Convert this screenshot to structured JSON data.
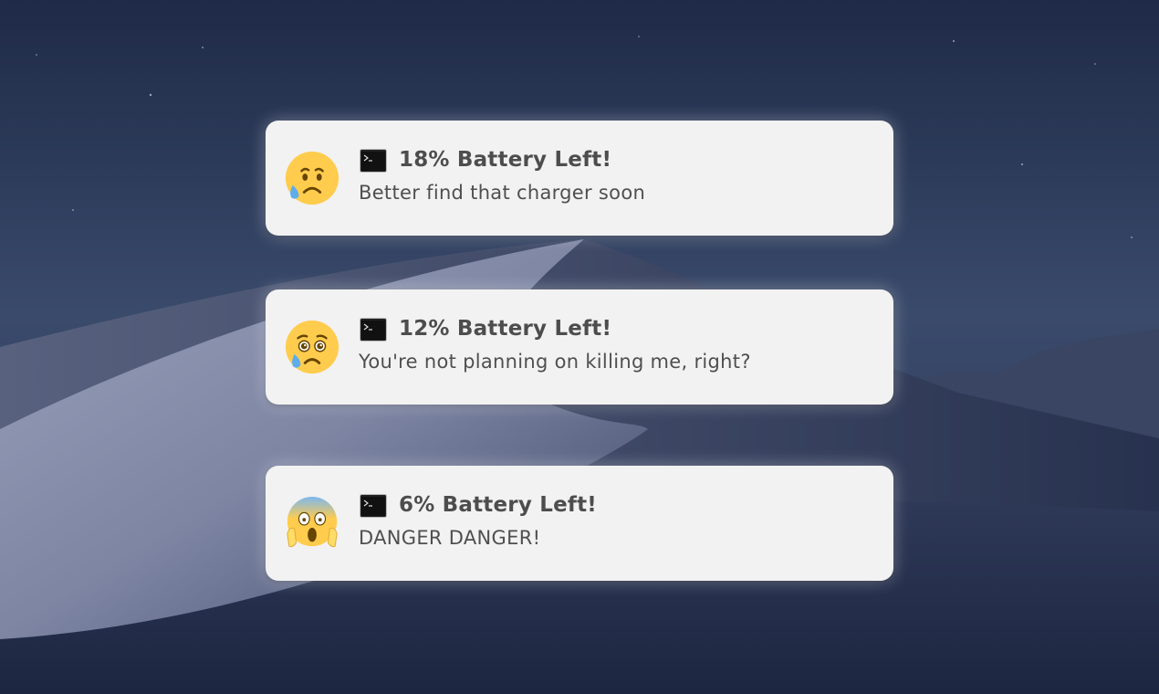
{
  "wallpaper": {
    "name": "desert-dune-night",
    "sky_color": "#2c3a5a",
    "dune_color": "#8c93ad"
  },
  "notifications": [
    {
      "app_icon": "terminal-icon",
      "emoji": "sad-but-relieved-face-icon",
      "title": "18% Battery Left!",
      "body": "Better find that charger soon"
    },
    {
      "app_icon": "terminal-icon",
      "emoji": "crying-face-icon",
      "title": "12% Battery Left!",
      "body": "You're not planning on killing me, right?"
    },
    {
      "app_icon": "terminal-icon",
      "emoji": "face-screaming-in-fear-icon",
      "title": "6% Battery Left!",
      "body": "DANGER DANGER!"
    }
  ]
}
